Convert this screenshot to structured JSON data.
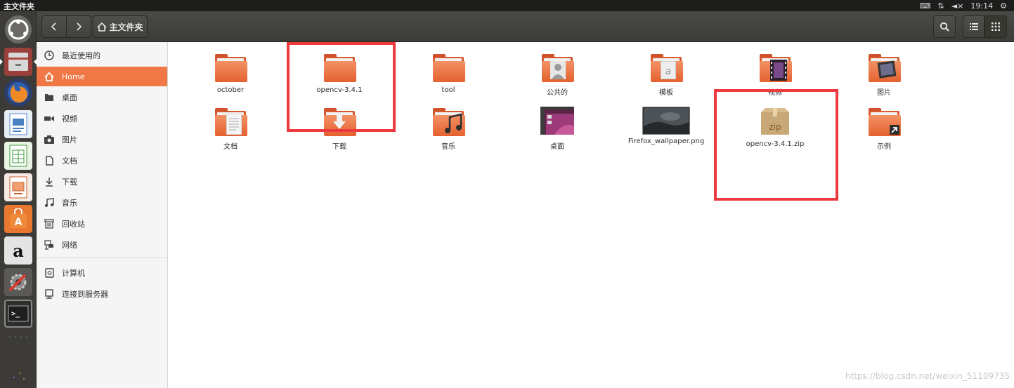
{
  "window": {
    "title": "主文件夹"
  },
  "tray": {
    "keyboard_icon": "keyboard-icon",
    "network_icon": "network-icon",
    "volume_icon": "volume-muted-icon",
    "time": "19:14",
    "settings_icon": "gear-icon"
  },
  "header": {
    "back_icon": "chevron-left-icon",
    "forward_icon": "chevron-right-icon",
    "path_label": "主文件夹",
    "search_icon": "search-icon",
    "list_view_icon": "list-view-icon",
    "grid_view_icon": "grid-view-icon"
  },
  "launcher": {
    "items": [
      "ubuntu-dash",
      "files",
      "firefox",
      "libreoffice-writer",
      "libreoffice-calc",
      "libreoffice-impress",
      "software-center",
      "amazon",
      "system-settings",
      "terminal"
    ]
  },
  "sidebar": {
    "items": [
      {
        "label": "最近使用的",
        "icon": "clock-icon"
      },
      {
        "label": "Home",
        "icon": "home-icon",
        "selected": true
      },
      {
        "label": "桌面",
        "icon": "desktop-folder-icon"
      },
      {
        "label": "视频",
        "icon": "video-icon"
      },
      {
        "label": "图片",
        "icon": "camera-icon"
      },
      {
        "label": "文档",
        "icon": "document-icon"
      },
      {
        "label": "下载",
        "icon": "download-icon"
      },
      {
        "label": "音乐",
        "icon": "music-icon"
      },
      {
        "label": "回收站",
        "icon": "trash-icon"
      },
      {
        "label": "网络",
        "icon": "network-icon"
      },
      {
        "label": "计算机",
        "icon": "computer-icon"
      },
      {
        "label": "连接到服务器",
        "icon": "server-icon"
      }
    ]
  },
  "files": [
    {
      "name": "october",
      "type": "folder"
    },
    {
      "name": "opencv-3.4.1",
      "type": "folder"
    },
    {
      "name": "tool",
      "type": "folder"
    },
    {
      "name": "公共的",
      "type": "folder-public"
    },
    {
      "name": "模板",
      "type": "folder-templates"
    },
    {
      "name": "视频",
      "type": "folder-videos"
    },
    {
      "name": "图片",
      "type": "folder-pictures"
    },
    {
      "name": "文档",
      "type": "folder-documents"
    },
    {
      "name": "下载",
      "type": "folder-downloads"
    },
    {
      "name": "音乐",
      "type": "folder-music"
    },
    {
      "name": "桌面",
      "type": "folder-desktop"
    },
    {
      "name": "Firefox_wallpaper.png",
      "type": "image"
    },
    {
      "name": "opencv-3.4.1.zip",
      "type": "zip",
      "icon_text": "zip"
    },
    {
      "name": "示例",
      "type": "folder-link"
    }
  ],
  "colors": {
    "accent": "#f07746",
    "highlight": "#ee3a3f",
    "folder": "#e4612f"
  },
  "watermark": "https://blog.csdn.net/weixin_51109735"
}
